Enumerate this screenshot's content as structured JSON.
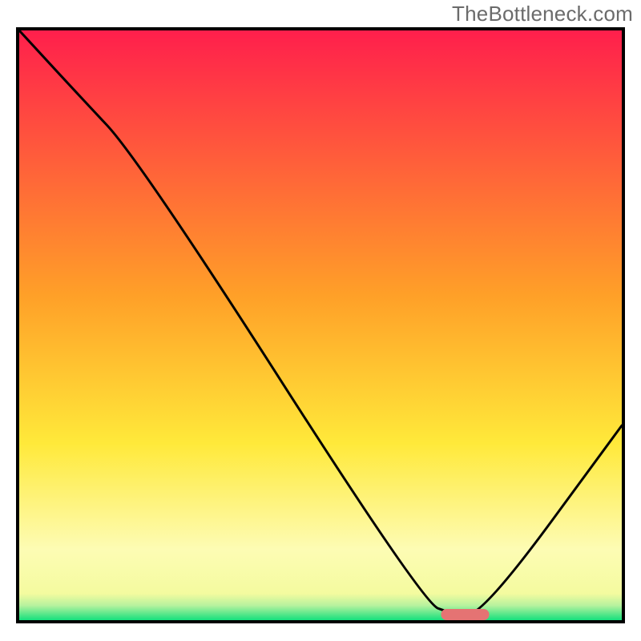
{
  "watermark": "TheBottleneck.com",
  "chart_data": {
    "type": "line",
    "title": "",
    "xlabel": "",
    "ylabel": "",
    "xlim": [
      0,
      100
    ],
    "ylim": [
      0,
      100
    ],
    "grid": false,
    "legend": false,
    "background_gradient": {
      "stops": [
        {
          "offset": 0.0,
          "color": "#ff1f4c"
        },
        {
          "offset": 0.45,
          "color": "#ffa028"
        },
        {
          "offset": 0.7,
          "color": "#ffe93a"
        },
        {
          "offset": 0.88,
          "color": "#fdfcb4"
        },
        {
          "offset": 0.955,
          "color": "#f4fb9f"
        },
        {
          "offset": 0.975,
          "color": "#b7f29e"
        },
        {
          "offset": 1.0,
          "color": "#15e07d"
        }
      ]
    },
    "series": [
      {
        "name": "bottleneck-curve",
        "x": [
          0,
          9,
          20,
          67,
          72,
          77,
          100
        ],
        "y": [
          100,
          90,
          78,
          3,
          1,
          1,
          33
        ]
      }
    ],
    "marker": {
      "name": "optimal-range",
      "shape": "rounded-bar",
      "color": "#e57373",
      "x_range": [
        70,
        78
      ],
      "y": 0
    }
  }
}
